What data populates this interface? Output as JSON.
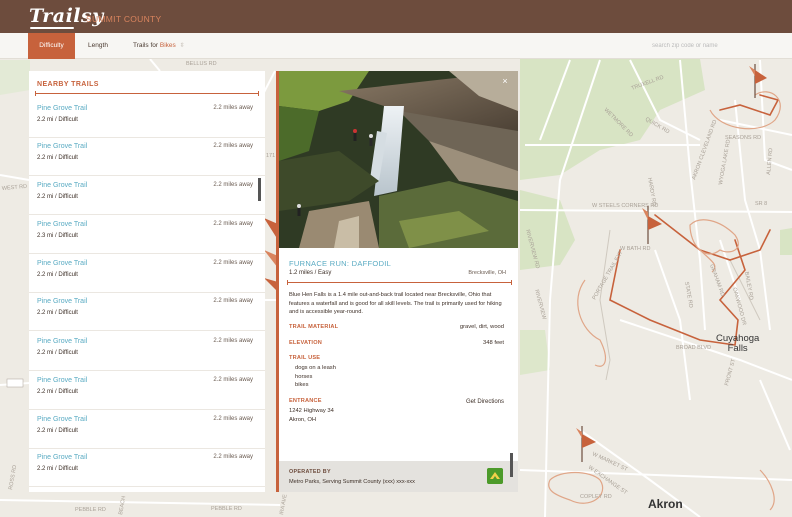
{
  "header": {
    "logo": "Trailsy",
    "county": "SUMMIT COUNTY"
  },
  "filters": {
    "difficulty": "Difficulty",
    "length": "Length",
    "trails_for_label": "Trails for",
    "trails_for_value": "Bikes",
    "caret": "⇳",
    "search_placeholder": "search zip code or name"
  },
  "list": {
    "title": "NEARBY TRAILS",
    "items": [
      {
        "name": "Pine Grove Trail",
        "distance": "2.2 miles away",
        "meta": "2.2 mi / Difficult"
      },
      {
        "name": "Pine Grove Trail",
        "distance": "2.2 miles away",
        "meta": "2.2 mi / Difficult"
      },
      {
        "name": "Pine Grove Trail",
        "distance": "2.2 miles away",
        "meta": "2.2 mi / Difficult"
      },
      {
        "name": "Pine Grove Trail",
        "distance": "2.2 miles away",
        "meta": "2.3 mi / Difficult"
      },
      {
        "name": "Pine Grove Trail",
        "distance": "2.2 miles away",
        "meta": "2.2 mi / Difficult"
      },
      {
        "name": "Pine Grove Trail",
        "distance": "2.2 miles away",
        "meta": "2.2 mi / Difficult"
      },
      {
        "name": "Pine Grove Trail",
        "distance": "2.2 miles away",
        "meta": "2.2 mi / Difficult"
      },
      {
        "name": "Pine Grove Trail",
        "distance": "2.2 miles away",
        "meta": "2.2 mi / Difficult"
      },
      {
        "name": "Pine Grove Trail",
        "distance": "2.2 miles away",
        "meta": "2.2 mi / Difficult"
      },
      {
        "name": "Pine Grove Trail",
        "distance": "2.2 miles away",
        "meta": "2.2 mi / Difficult"
      }
    ]
  },
  "detail": {
    "close": "×",
    "title": "FURNACE RUN: DAFFODIL",
    "subtitle": "1.2 miles / Easy",
    "location": "Brecksville, OH",
    "description": "Blue Hen Falls is a 1.4 mile out-and-back trail located near Brecksville, Ohio that features a waterfall and is good for all skill levels. The trail is primarily used for hiking and is accessible year-round.",
    "material_label": "TRAIL MATERIAL",
    "material_value": "gravel, dirt, wood",
    "elevation_label": "ELEVATION",
    "elevation_value": "348 feet",
    "use_label": "TRAIL USE",
    "uses": [
      "dogs on a leash",
      "horses",
      "bikes"
    ],
    "entrance_label": "ENTRANCE",
    "address_line1": "1242 Highway 34",
    "address_line2": "Akron, OH",
    "directions": "Get Directions",
    "operated_label": "OPERATED BY",
    "operated_text": "Metro Parks, Serving Summit County  (xxx) xxx-xxx"
  },
  "map": {
    "labels": {
      "akron": "Akron",
      "cuyahoga_1": "Cuyahoga",
      "cuyahoga_2": "Falls"
    },
    "streets": [
      "BELLUS RD",
      "TRUXELL RD",
      "QUICK RD",
      "WETMORE RD",
      "AKRON CLEVELAND RD",
      "WYOGA LAKE RD",
      "SEASONS RD",
      "ALLEN RD",
      "SR 8",
      "W STEELS CORNERS RD",
      "W BATH RD",
      "RIVERVIEW RD",
      "HARDY RD",
      "STATE RD",
      "GRAHAM RD",
      "BAILEY RD",
      "OAKWOOD DR",
      "BROAD BLVD",
      "FRONT ST",
      "W MARKET ST",
      "W EXCHANGE ST",
      "COPLEY RD",
      "PORTAGE TRAIL EXT",
      "WEST RD",
      "RIVERVIEW",
      "PEBBLE RD",
      "BEACH",
      "IRA AVE",
      "ROSS RD",
      "171"
    ]
  },
  "colors": {
    "brand_brown": "#6d4c3d",
    "accent_orange": "#c7623c",
    "link_blue": "#5aabc3"
  }
}
